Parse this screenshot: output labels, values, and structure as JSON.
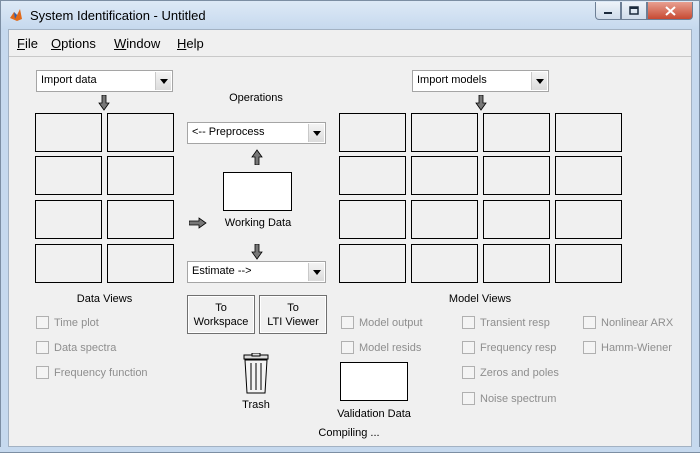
{
  "window": {
    "title": "System Identification - Untitled"
  },
  "menu": [
    {
      "label": "File"
    },
    {
      "label": "Options"
    },
    {
      "label": "Window"
    },
    {
      "label": "Help"
    }
  ],
  "data_panel": {
    "import_dropdown": "Import data",
    "views_label": "Data Views",
    "checks": [
      "Time plot",
      "Data spectra",
      "Frequency function"
    ]
  },
  "operations": {
    "heading": "Operations",
    "preprocess_dropdown": "<-- Preprocess",
    "working_data_label": "Working Data",
    "estimate_dropdown": "Estimate -->",
    "to_workspace_line1": "To",
    "to_workspace_line2": "Workspace",
    "to_lti_line1": "To",
    "to_lti_line2": "LTI Viewer",
    "trash_label": "Trash",
    "validation_label": "Validation Data"
  },
  "model_panel": {
    "import_dropdown": "Import models",
    "views_label": "Model Views",
    "checks_col1": [
      "Model output",
      "Model resids"
    ],
    "checks_col2": [
      "Transient resp",
      "Frequency resp",
      "Zeros and poles",
      "Noise spectrum"
    ],
    "checks_col3": [
      "Nonlinear ARX",
      "Hamm-Wiener"
    ]
  },
  "status": {
    "text": "Compiling ..."
  },
  "colors": {
    "titlebar": "#c6d9ee",
    "close_button": "#c74a33",
    "panel_bg": "#f0f0f0"
  }
}
